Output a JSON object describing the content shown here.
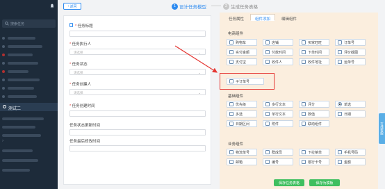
{
  "sidebar": {
    "search_placeholder": "搜索任务",
    "active_item": "测试二"
  },
  "header": {
    "back_label": "返回",
    "step1": {
      "num": "1",
      "label": "设计任务模型"
    },
    "step2": {
      "num": "2",
      "label": "生成任务表格"
    }
  },
  "form": {
    "title_label": "任务标题",
    "executor_label": "任务执行人",
    "executor_placeholder": "请选择",
    "status_label": "任务状态",
    "status_placeholder": "请选择",
    "creator_label": "任务创建人",
    "creator_placeholder": "请选择",
    "created_time_label": "任务创建时间",
    "status_change_time_label": "任务状态更新时间",
    "last_modified_label": "任务最后修改时间"
  },
  "palette": {
    "tabs": [
      "任务属性",
      "组件添加",
      "编辑组件"
    ],
    "ecommerce_title": "电商组件",
    "ecommerce_items": [
      "购物车",
      "店铺",
      "买家旺旺",
      "订单号",
      "实付金额",
      "付款时间",
      "下单时间",
      "评价截图",
      "支付宝",
      "收件人",
      "收件地址",
      "运单号"
    ],
    "sub_order_item": "子订单号",
    "basic_title": "基础组件",
    "basic_items": [
      "单行文本",
      "多行文本",
      "评分",
      "单选",
      "多选",
      "单行文本",
      "数值",
      "日期",
      "日期区间",
      "附件",
      "联动组件"
    ],
    "basic_items_display": [
      "优先级",
      "多行文本",
      "评分",
      "单选",
      "多选",
      "单行文本",
      "数值",
      "日期",
      "日期区间",
      "附件",
      "联动组件"
    ],
    "business_title": "业务组件",
    "business_items": [
      "物流单号",
      "群成员",
      "下拉菜单",
      "手机号码",
      "邮箱",
      "编号",
      "银行卡号",
      "金额"
    ],
    "save_task_label": "保存任务表格",
    "save_template_label": "保存为模板"
  },
  "side_tab_label": "在线客服"
}
